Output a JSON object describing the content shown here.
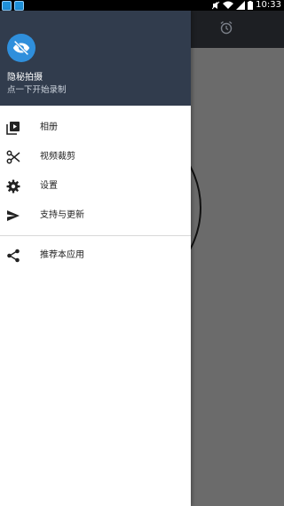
{
  "status_bar": {
    "time": "10:33"
  },
  "drawer": {
    "header": {
      "app_name": "隐秘拍摄",
      "subtitle": "点一下开始录制",
      "avatar_icon": "eye-off-icon",
      "background_color": "#313c4d",
      "accent_color": "#2f8fdc"
    },
    "menu": [
      {
        "id": "album",
        "label": "相册",
        "icon": "video-library-icon"
      },
      {
        "id": "video-trim",
        "label": "视频裁剪",
        "icon": "scissors-icon"
      },
      {
        "id": "settings",
        "label": "设置",
        "icon": "gear-icon"
      },
      {
        "id": "support",
        "label": "支持与更新",
        "icon": "send-icon"
      }
    ],
    "secondary_menu": [
      {
        "id": "recommend",
        "label": "推荐本应用",
        "icon": "share-icon"
      }
    ]
  },
  "background": {
    "toolbar_icon": "alarm-clock-icon"
  }
}
